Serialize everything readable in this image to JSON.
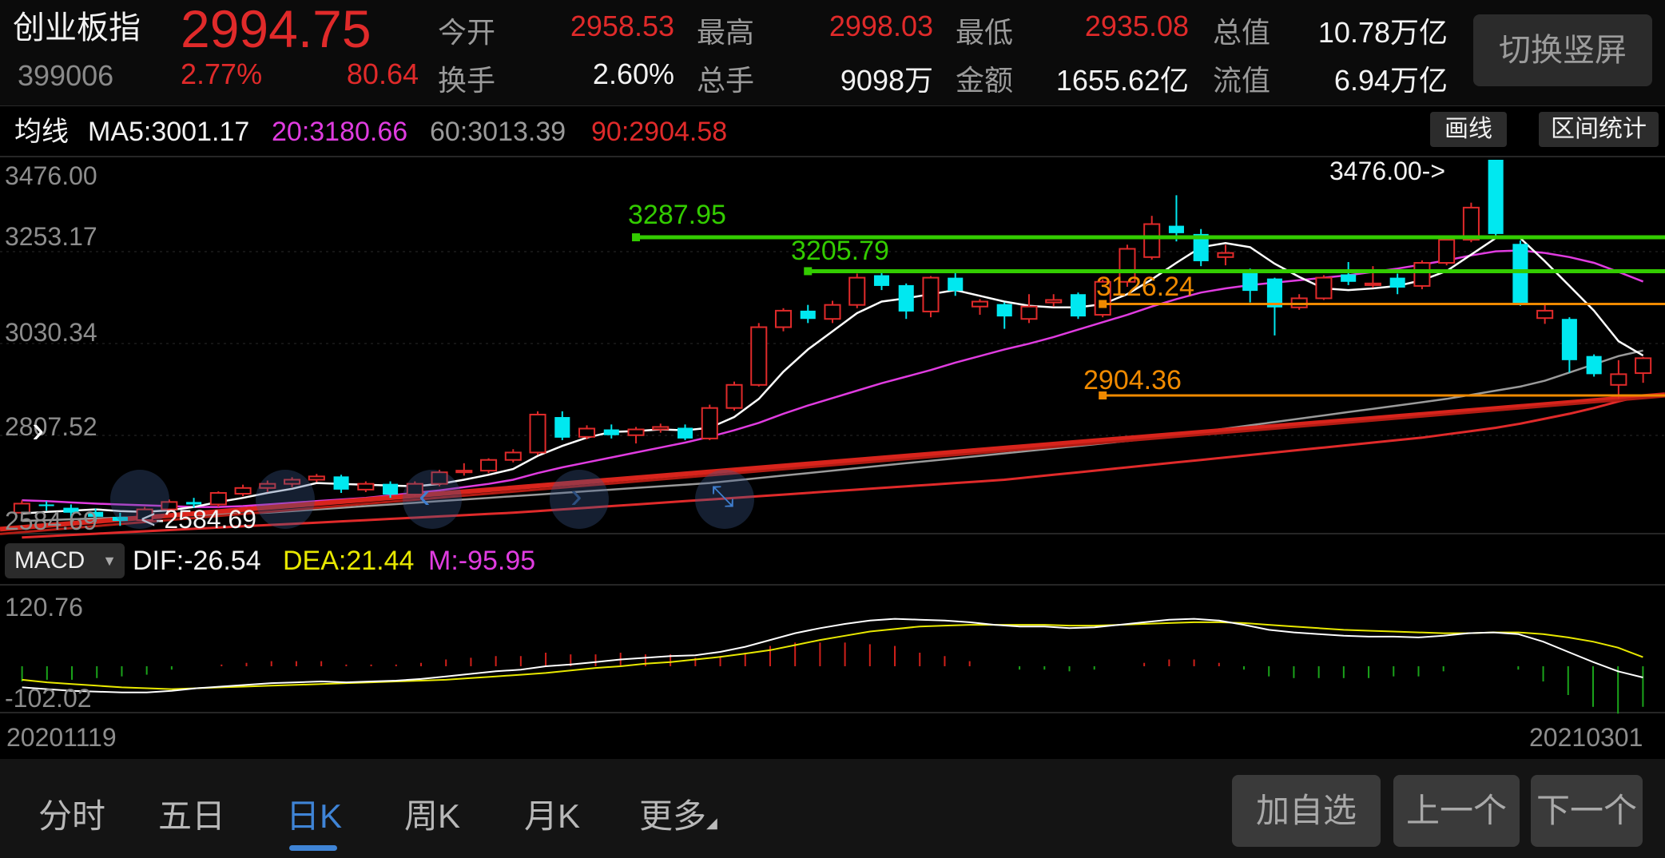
{
  "header": {
    "name": "创业板指",
    "code": "399006",
    "price": "2994.75",
    "change_pct": "2.77%",
    "change_abs": "80.64",
    "stats_row1": [
      {
        "label": "今开",
        "value": "2958.53"
      },
      {
        "label": "最高",
        "value": "2998.03"
      },
      {
        "label": "最低",
        "value": "2935.08"
      },
      {
        "label": "总值",
        "value": "10.78万亿"
      }
    ],
    "stats_row2": [
      {
        "label": "换手",
        "value": "2.60%"
      },
      {
        "label": "总手",
        "value": "9098万"
      },
      {
        "label": "金额",
        "value": "1655.62亿"
      },
      {
        "label": "流值",
        "value": "6.94万亿"
      }
    ],
    "switch_label": "切换竖屏"
  },
  "ma_row": {
    "label": "均线",
    "ma5": "MA5:3001.17",
    "ma20": "20:3180.66",
    "ma60": "60:3013.39",
    "ma90": "90:2904.58",
    "draw_label": "画线",
    "interval_label": "区间统计"
  },
  "kline_axis": {
    "y_labels": [
      "3476.00",
      "3253.17",
      "3030.34",
      "2807.52",
      "2584.69"
    ],
    "max_marker": "3476.00->",
    "min_marker": "<-2584.69"
  },
  "drawn_lines": [
    {
      "label": "3287.95",
      "color": "#33cc00"
    },
    {
      "label": "3205.79",
      "color": "#33cc00"
    },
    {
      "label": "3126.24",
      "color": "#f08a00"
    },
    {
      "label": "2904.36",
      "color": "#f08a00"
    }
  ],
  "macd": {
    "indicator_label": "MACD",
    "dif": "DIF:-26.54",
    "dea": "DEA:21.44",
    "m": "M:-95.95",
    "y_top": "120.76",
    "y_bottom": "-102.02"
  },
  "dates": {
    "start": "20201119",
    "end": "20210301"
  },
  "period_tabs": [
    "分时",
    "五日",
    "日K",
    "周K",
    "月K",
    "更多"
  ],
  "active_tab": "日K",
  "bottom_buttons": {
    "add": "加自选",
    "prev": "上一个",
    "next": "下一个"
  },
  "colors": {
    "up": "#e02a2a",
    "down": "#00e8f0",
    "ma5": "#ffffff",
    "ma20": "#e03ce0",
    "ma60": "#9a9a9a",
    "ma90": "#e02a2a"
  },
  "chart_data": {
    "type": "candlestick",
    "title": "",
    "ylim": [
      2584.69,
      3476.0
    ],
    "macd_ylim": [
      -102.02,
      120.76
    ],
    "candles": [
      {
        "o": 2620,
        "c": 2642,
        "h": 2650,
        "l": 2610
      },
      {
        "o": 2640,
        "c": 2636,
        "h": 2648,
        "l": 2625
      },
      {
        "o": 2632,
        "c": 2620,
        "h": 2640,
        "l": 2605
      },
      {
        "o": 2622,
        "c": 2610,
        "h": 2630,
        "l": 2598
      },
      {
        "o": 2610,
        "c": 2600,
        "h": 2620,
        "l": 2588
      },
      {
        "o": 2602,
        "c": 2628,
        "h": 2634,
        "l": 2596
      },
      {
        "o": 2628,
        "c": 2646,
        "h": 2652,
        "l": 2620
      },
      {
        "o": 2646,
        "c": 2640,
        "h": 2656,
        "l": 2632
      },
      {
        "o": 2640,
        "c": 2668,
        "h": 2672,
        "l": 2634
      },
      {
        "o": 2666,
        "c": 2680,
        "h": 2688,
        "l": 2660
      },
      {
        "o": 2680,
        "c": 2690,
        "h": 2698,
        "l": 2670
      },
      {
        "o": 2690,
        "c": 2700,
        "h": 2706,
        "l": 2682
      },
      {
        "o": 2700,
        "c": 2708,
        "h": 2714,
        "l": 2694
      },
      {
        "o": 2708,
        "c": 2676,
        "h": 2712,
        "l": 2668
      },
      {
        "o": 2676,
        "c": 2690,
        "h": 2696,
        "l": 2670
      },
      {
        "o": 2690,
        "c": 2664,
        "h": 2696,
        "l": 2656
      },
      {
        "o": 2664,
        "c": 2690,
        "h": 2696,
        "l": 2660
      },
      {
        "o": 2690,
        "c": 2718,
        "h": 2724,
        "l": 2684
      },
      {
        "o": 2718,
        "c": 2722,
        "h": 2740,
        "l": 2710
      },
      {
        "o": 2722,
        "c": 2748,
        "h": 2752,
        "l": 2716
      },
      {
        "o": 2748,
        "c": 2766,
        "h": 2774,
        "l": 2742
      },
      {
        "o": 2766,
        "c": 2858,
        "h": 2866,
        "l": 2760
      },
      {
        "o": 2852,
        "c": 2802,
        "h": 2866,
        "l": 2796
      },
      {
        "o": 2804,
        "c": 2824,
        "h": 2832,
        "l": 2798
      },
      {
        "o": 2822,
        "c": 2808,
        "h": 2834,
        "l": 2800
      },
      {
        "o": 2808,
        "c": 2822,
        "h": 2828,
        "l": 2788
      },
      {
        "o": 2822,
        "c": 2828,
        "h": 2836,
        "l": 2814
      },
      {
        "o": 2826,
        "c": 2800,
        "h": 2834,
        "l": 2796
      },
      {
        "o": 2800,
        "c": 2874,
        "h": 2882,
        "l": 2796
      },
      {
        "o": 2874,
        "c": 2930,
        "h": 2938,
        "l": 2868
      },
      {
        "o": 2930,
        "c": 3070,
        "h": 3080,
        "l": 2926
      },
      {
        "o": 3070,
        "c": 3110,
        "h": 3116,
        "l": 3060
      },
      {
        "o": 3110,
        "c": 3090,
        "h": 3124,
        "l": 3080
      },
      {
        "o": 3090,
        "c": 3124,
        "h": 3134,
        "l": 3080
      },
      {
        "o": 3124,
        "c": 3190,
        "h": 3200,
        "l": 3116
      },
      {
        "o": 3196,
        "c": 3170,
        "h": 3206,
        "l": 3160
      },
      {
        "o": 3172,
        "c": 3108,
        "h": 3176,
        "l": 3090
      },
      {
        "o": 3108,
        "c": 3190,
        "h": 3194,
        "l": 3094
      },
      {
        "o": 3190,
        "c": 3158,
        "h": 3210,
        "l": 3146
      },
      {
        "o": 3120,
        "c": 3132,
        "h": 3138,
        "l": 3100
      },
      {
        "o": 3126,
        "c": 3096,
        "h": 3130,
        "l": 3066
      },
      {
        "o": 3090,
        "c": 3120,
        "h": 3150,
        "l": 3080
      },
      {
        "o": 3130,
        "c": 3136,
        "h": 3150,
        "l": 3120
      },
      {
        "o": 3150,
        "c": 3096,
        "h": 3154,
        "l": 3090
      },
      {
        "o": 3100,
        "c": 3180,
        "h": 3186,
        "l": 3094
      },
      {
        "o": 3180,
        "c": 3260,
        "h": 3270,
        "l": 3168
      },
      {
        "o": 3240,
        "c": 3320,
        "h": 3340,
        "l": 3234
      },
      {
        "o": 3316,
        "c": 3298,
        "h": 3390,
        "l": 3278
      },
      {
        "o": 3296,
        "c": 3230,
        "h": 3308,
        "l": 3218
      },
      {
        "o": 3240,
        "c": 3250,
        "h": 3270,
        "l": 3220
      },
      {
        "o": 3210,
        "c": 3158,
        "h": 3212,
        "l": 3130
      },
      {
        "o": 3188,
        "c": 3118,
        "h": 3190,
        "l": 3050
      },
      {
        "o": 3118,
        "c": 3140,
        "h": 3150,
        "l": 3112
      },
      {
        "o": 3140,
        "c": 3190,
        "h": 3196,
        "l": 3136
      },
      {
        "o": 3198,
        "c": 3180,
        "h": 3228,
        "l": 3172
      },
      {
        "o": 3172,
        "c": 3176,
        "h": 3218,
        "l": 3166
      },
      {
        "o": 3190,
        "c": 3166,
        "h": 3200,
        "l": 3150
      },
      {
        "o": 3170,
        "c": 3226,
        "h": 3232,
        "l": 3162
      },
      {
        "o": 3226,
        "c": 3282,
        "h": 3292,
        "l": 3220
      },
      {
        "o": 3282,
        "c": 3360,
        "h": 3372,
        "l": 3276
      },
      {
        "o": 3476,
        "c": 3296,
        "h": 3476,
        "l": 3290
      },
      {
        "o": 3272,
        "c": 3128,
        "h": 3280,
        "l": 3122
      },
      {
        "o": 3092,
        "c": 3110,
        "h": 3128,
        "l": 3078
      },
      {
        "o": 3090,
        "c": 2990,
        "h": 3094,
        "l": 2960
      },
      {
        "o": 3000,
        "c": 2956,
        "h": 3004,
        "l": 2950
      },
      {
        "o": 2930,
        "c": 2956,
        "h": 2990,
        "l": 2896
      },
      {
        "o": 2958.53,
        "c": 2994.75,
        "h": 2998.03,
        "l": 2935.08
      }
    ],
    "ma5": [
      2618,
      2622,
      2625,
      2628,
      2624,
      2622,
      2626,
      2634,
      2646,
      2656,
      2668,
      2678,
      2692,
      2690,
      2688,
      2686,
      2684,
      2690,
      2700,
      2712,
      2726,
      2758,
      2782,
      2802,
      2816,
      2818,
      2822,
      2820,
      2826,
      2852,
      2896,
      2962,
      3016,
      3060,
      3104,
      3132,
      3140,
      3150,
      3160,
      3146,
      3132,
      3122,
      3118,
      3118,
      3126,
      3150,
      3186,
      3226,
      3264,
      3274,
      3264,
      3224,
      3192,
      3164,
      3160,
      3164,
      3170,
      3184,
      3206,
      3246,
      3286,
      3286,
      3230,
      3170,
      3110,
      3036,
      3001
    ],
    "ma20": [
      2650,
      2648,
      2645,
      2642,
      2640,
      2638,
      2636,
      2634,
      2634,
      2636,
      2640,
      2644,
      2648,
      2652,
      2656,
      2662,
      2668,
      2674,
      2682,
      2690,
      2700,
      2716,
      2730,
      2742,
      2754,
      2766,
      2778,
      2790,
      2804,
      2820,
      2838,
      2860,
      2880,
      2898,
      2916,
      2934,
      2950,
      2966,
      2984,
      3000,
      3016,
      3030,
      3046,
      3064,
      3082,
      3100,
      3120,
      3138,
      3154,
      3164,
      3172,
      3178,
      3184,
      3190,
      3196,
      3204,
      3212,
      3222,
      3232,
      3244,
      3254,
      3256,
      3250,
      3240,
      3226,
      3204,
      3180.66
    ],
    "ma60": [
      2600,
      2602,
      2604,
      2606,
      2608,
      2610,
      2612,
      2614,
      2616,
      2618,
      2620,
      2624,
      2628,
      2632,
      2636,
      2640,
      2644,
      2648,
      2652,
      2656,
      2660,
      2664,
      2668,
      2672,
      2676,
      2680,
      2684,
      2688,
      2692,
      2698,
      2704,
      2710,
      2716,
      2722,
      2728,
      2734,
      2740,
      2746,
      2752,
      2758,
      2764,
      2770,
      2776,
      2782,
      2788,
      2794,
      2800,
      2808,
      2816,
      2824,
      2832,
      2840,
      2848,
      2856,
      2864,
      2872,
      2880,
      2888,
      2896,
      2906,
      2916,
      2926,
      2940,
      2960,
      2980,
      3000,
      3013.39
    ],
    "ma90": [
      2560,
      2563,
      2566,
      2569,
      2572,
      2575,
      2578,
      2581,
      2584,
      2587,
      2590,
      2593,
      2596,
      2599,
      2602,
      2605,
      2608,
      2611,
      2614,
      2617,
      2620,
      2624,
      2628,
      2632,
      2636,
      2640,
      2644,
      2648,
      2652,
      2656,
      2660,
      2664,
      2668,
      2672,
      2676,
      2680,
      2684,
      2688,
      2692,
      2696,
      2700,
      2706,
      2712,
      2718,
      2724,
      2730,
      2736,
      2742,
      2748,
      2754,
      2760,
      2766,
      2772,
      2778,
      2784,
      2790,
      2796,
      2802,
      2810,
      2818,
      2826,
      2836,
      2848,
      2860,
      2874,
      2890,
      2904.58
    ],
    "trend_line": {
      "from": 2580,
      "to": 2906
    },
    "horizontal_lines": [
      {
        "value": 3287.95,
        "start_index": 25
      },
      {
        "value": 3205.79,
        "start_index": 32
      },
      {
        "value": 3126.24,
        "start_index": 44
      },
      {
        "value": 2904.36,
        "start_index": 44
      }
    ],
    "macd_dif": [
      -50,
      -54,
      -58,
      -60,
      -62,
      -62,
      -58,
      -52,
      -48,
      -44,
      -40,
      -38,
      -36,
      -38,
      -36,
      -34,
      -30,
      -24,
      -18,
      -12,
      -8,
      0,
      4,
      10,
      16,
      20,
      24,
      26,
      34,
      46,
      62,
      78,
      90,
      100,
      108,
      112,
      110,
      108,
      104,
      98,
      94,
      94,
      90,
      92,
      98,
      104,
      110,
      112,
      108,
      98,
      86,
      80,
      76,
      72,
      70,
      70,
      68,
      72,
      78,
      80,
      76,
      58,
      34,
      10,
      -12,
      -26.54
    ],
    "macd_dea": [
      -32,
      -38,
      -42,
      -46,
      -50,
      -52,
      -54,
      -52,
      -50,
      -48,
      -46,
      -44,
      -42,
      -40,
      -38,
      -36,
      -34,
      -32,
      -28,
      -24,
      -20,
      -16,
      -10,
      -4,
      0,
      6,
      10,
      16,
      22,
      30,
      38,
      50,
      62,
      72,
      82,
      88,
      94,
      96,
      98,
      98,
      98,
      98,
      96,
      96,
      98,
      100,
      102,
      104,
      104,
      102,
      98,
      94,
      90,
      86,
      84,
      82,
      80,
      78,
      78,
      80,
      80,
      76,
      68,
      58,
      44,
      21.44
    ],
    "macd_hist": [
      -36,
      -32,
      -32,
      -28,
      -24,
      -20,
      -8,
      0,
      4,
      8,
      12,
      12,
      12,
      4,
      4,
      4,
      8,
      16,
      20,
      24,
      24,
      32,
      28,
      28,
      32,
      28,
      28,
      20,
      24,
      32,
      48,
      56,
      56,
      56,
      52,
      48,
      32,
      24,
      12,
      0,
      -8,
      -8,
      -12,
      -8,
      0,
      8,
      16,
      16,
      8,
      -8,
      -24,
      -28,
      -28,
      -28,
      -28,
      -24,
      -24,
      -12,
      0,
      0,
      -8,
      -36,
      -68,
      -96,
      -112,
      -95.95
    ]
  }
}
